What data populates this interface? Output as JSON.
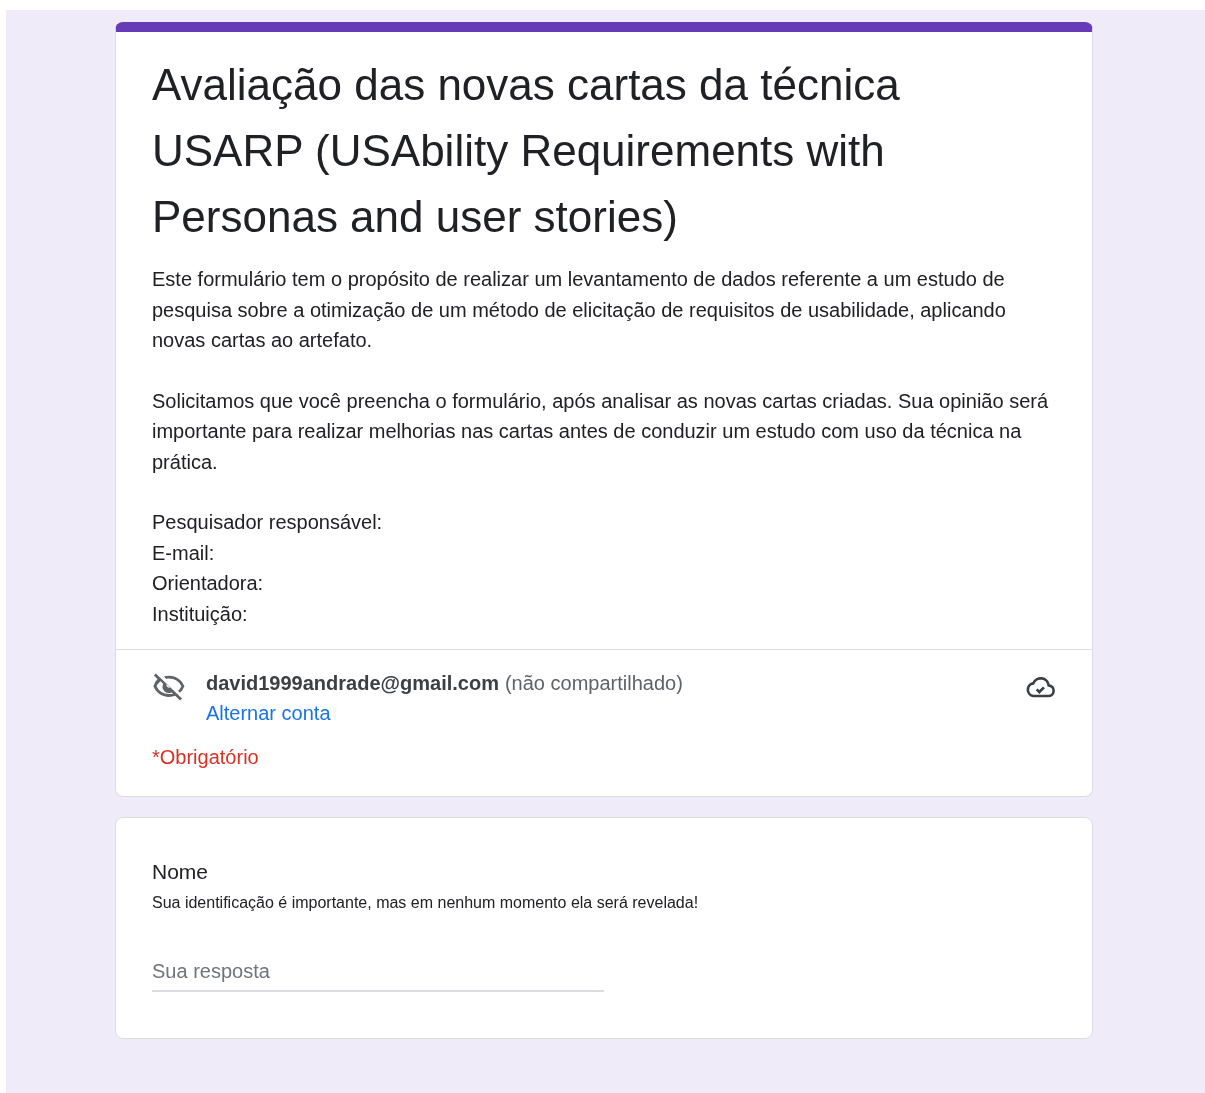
{
  "form": {
    "title": "Avaliação das novas cartas da técnica USARP (USAbility Requirements with Personas and user stories)",
    "description": [
      [
        "Este formulário tem o propósito de realizar um levantamento de dados referente a um estudo de pesquisa sobre a otimização de um método de elicitação de requisitos de usabilidade, aplicando novas cartas ao artefato."
      ],
      [
        "Solicitamos que você preencha o formulário, após analisar as novas cartas criadas. Sua opinião será importante para realizar melhorias nas cartas antes de conduzir um estudo com uso da técnica na prática."
      ],
      [
        "Pesquisador responsável:",
        "E-mail:",
        "Orientadora:",
        "Instituição:"
      ]
    ],
    "account": {
      "email": "david1999andrade@gmail.com",
      "note": "(não compartilhado)",
      "switch_link": "Alternar conta"
    },
    "required_note": "*Obrigatório"
  },
  "questions": [
    {
      "title": "Nome",
      "help": "Sua identificação é importante, mas em nenhum momento ela será revelada!",
      "placeholder": "Sua resposta"
    }
  ]
}
